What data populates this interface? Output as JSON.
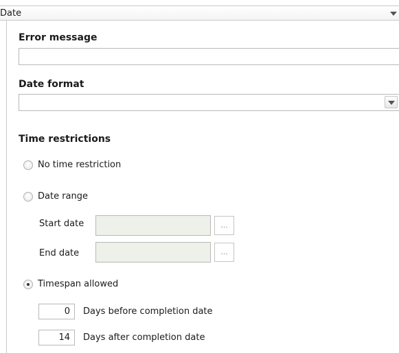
{
  "validation_type": {
    "selected": "Date"
  },
  "error_message": {
    "heading": "Error message",
    "value": ""
  },
  "date_format": {
    "heading": "Date format",
    "selected": ""
  },
  "time_restrictions": {
    "heading": "Time restrictions",
    "options": [
      {
        "label": "No time restriction",
        "checked": false
      },
      {
        "label": "Date range",
        "checked": false
      },
      {
        "label": "Timespan allowed",
        "checked": true
      }
    ],
    "date_range": {
      "start_label": "Start date",
      "start_value": "",
      "end_label": "End date",
      "end_value": "",
      "picker_label": "..."
    },
    "timespan": {
      "days_before": "0",
      "days_before_label": "Days before completion date",
      "days_after": "14",
      "days_after_label": "Days after completion date"
    }
  }
}
